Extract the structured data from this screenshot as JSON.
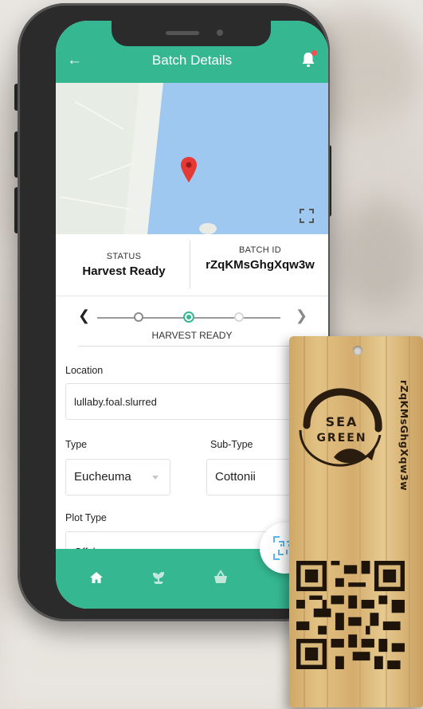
{
  "header": {
    "title": "Batch Details",
    "back_icon": "arrow-left-icon",
    "notification_icon": "bell-icon"
  },
  "map": {
    "pin_icon": "map-pin-icon",
    "fullscreen_icon": "fullscreen-icon"
  },
  "summary": {
    "status_label": "STATUS",
    "status_value": "Harvest Ready",
    "batch_label": "BATCH ID",
    "batch_value": "rZqKMsGhgXqw3w"
  },
  "stepper": {
    "current_label": "HARVEST READY",
    "prev_icon": "chevron-left-icon",
    "next_icon": "chevron-right-icon"
  },
  "form": {
    "location_label": "Location",
    "location_value": "lullaby.foal.slurred",
    "type_label": "Type",
    "type_value": "Eucheuma",
    "subtype_label": "Sub-Type",
    "subtype_value": "Cottonii",
    "plot_type_label": "Plot Type",
    "plot_type_value": "Offshore"
  },
  "bottom_nav": {
    "items": [
      "home-icon",
      "seedling-icon",
      "basket-icon"
    ],
    "fab_icon": "qr-scan-icon"
  },
  "tag": {
    "logo_line1": "SEA",
    "logo_line2": "GREEN",
    "vertical_id": "rZqKMsGhgXqw3w"
  },
  "colors": {
    "accent": "#35b791",
    "map_water": "#9fc8f0",
    "pin": "#e53935"
  }
}
